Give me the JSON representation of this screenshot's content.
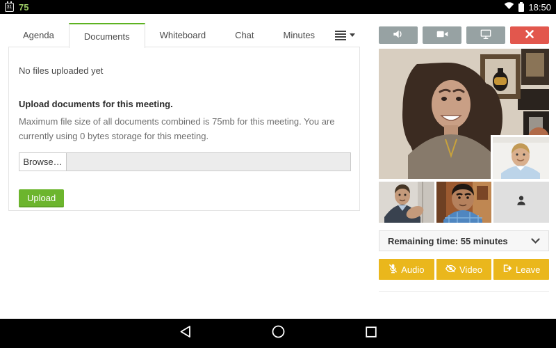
{
  "status_bar": {
    "calendar_day": "31",
    "notification_count": "75",
    "time": "18:50",
    "icons": [
      "calendar-icon",
      "wifi-icon",
      "battery-icon"
    ],
    "accent_green": "#9ccc65"
  },
  "tabs": [
    {
      "label": "Agenda",
      "active": false
    },
    {
      "label": "Documents",
      "active": true
    },
    {
      "label": "Whiteboard",
      "active": false
    },
    {
      "label": "Chat",
      "active": false
    },
    {
      "label": "Minutes",
      "active": false
    }
  ],
  "tab_menu_icon": "list-menu-icon",
  "documents_panel": {
    "empty_message": "No files uploaded yet",
    "upload_heading": "Upload documents for this meeting.",
    "upload_info": "Maximum file size of all documents combined is 75mb for this meeting. You are currently using 0 bytes storage for this meeting.",
    "browse_label": "Browse…",
    "file_field_value": "",
    "upload_label": "Upload",
    "active_tab_accent": "#5db321",
    "upload_button_color": "#6cb52d"
  },
  "video_panel": {
    "controls": [
      {
        "icon": "speaker-icon",
        "color": "#97a2a3"
      },
      {
        "icon": "video-camera-icon",
        "color": "#97a2a3"
      },
      {
        "icon": "screen-share-icon",
        "color": "#97a2a3"
      },
      {
        "icon": "end-call-icon",
        "color": "#e2574d"
      }
    ],
    "participants": [
      "main-video-woman-curly-hair",
      "thumb-blond-man-blue-shirt",
      "thumb-man-gesturing",
      "thumb-man-plaid-shirt",
      "thumb-empty-placeholder"
    ],
    "remaining_time_label": "Remaining time: 55 minutes",
    "actions": [
      {
        "label": "Audio",
        "icon": "microphone-slash-icon"
      },
      {
        "label": "Video",
        "icon": "eye-slash-icon"
      },
      {
        "label": "Leave",
        "icon": "sign-out-icon"
      }
    ],
    "action_color": "#eab71c"
  },
  "nav_bar": {
    "icons": [
      "back-icon",
      "home-icon",
      "recents-icon"
    ]
  }
}
